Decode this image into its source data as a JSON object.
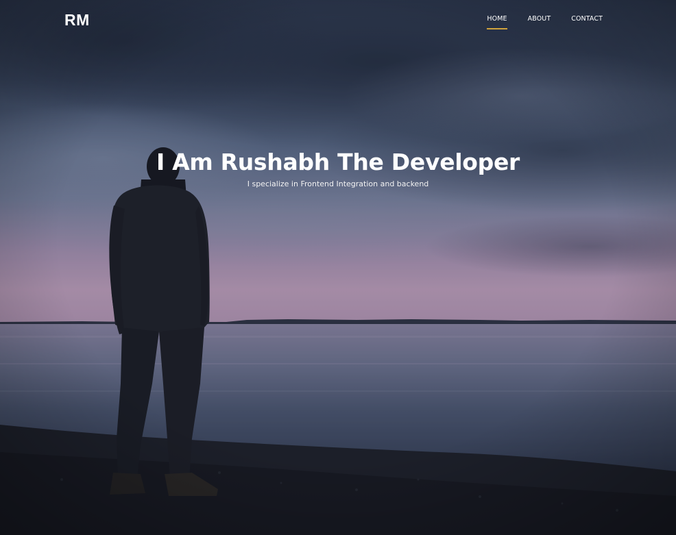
{
  "header": {
    "logo_text": "RM"
  },
  "nav": {
    "items": [
      {
        "label": "HOME",
        "active": true
      },
      {
        "label": "ABOUT",
        "active": false
      },
      {
        "label": "CONTACT",
        "active": false
      }
    ]
  },
  "hero": {
    "title": "I Am Rushabh The Developer",
    "subtitle": "I specialize in Frontend Integration and backend",
    "background_image": "man-standing-at-lake-shore-at-dusk"
  },
  "colors": {
    "nav_active_underline": "#d1a33c",
    "text": "#ffffff"
  }
}
